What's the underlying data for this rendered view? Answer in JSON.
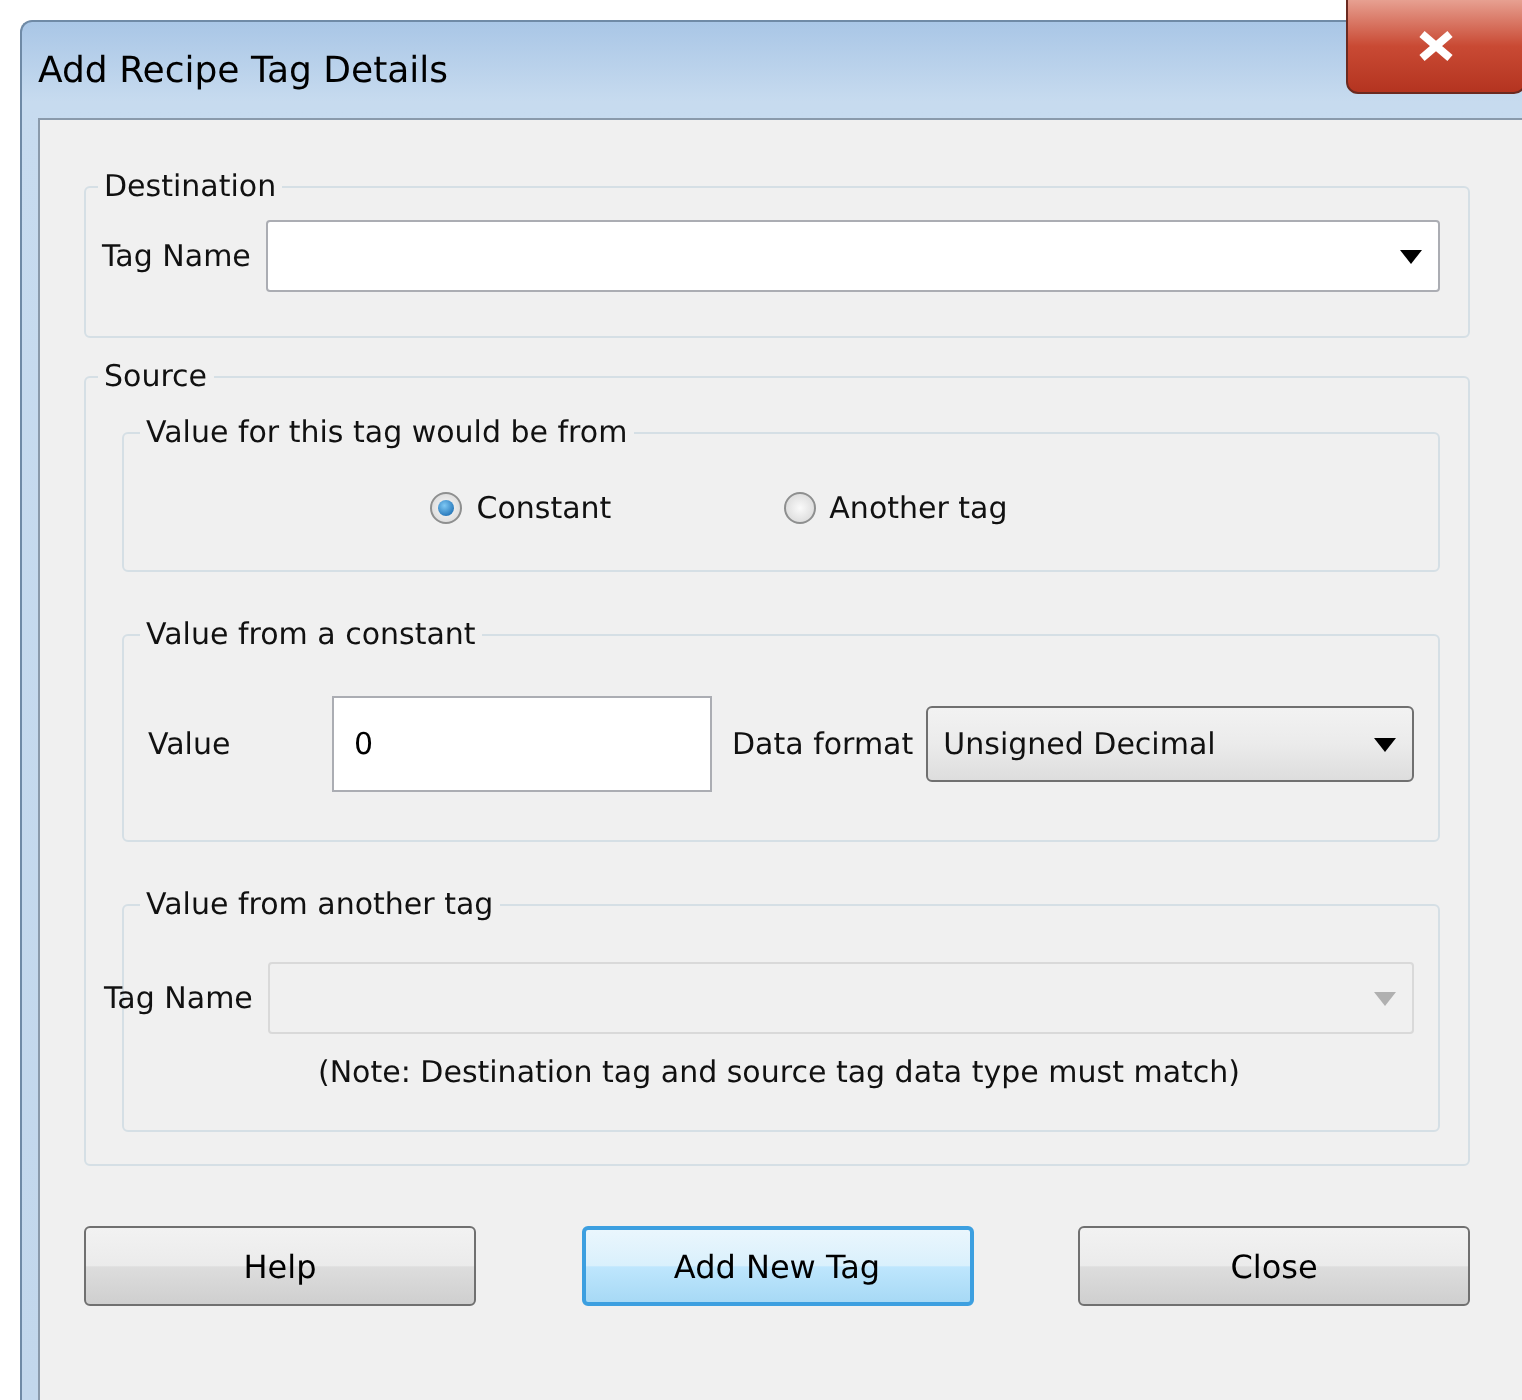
{
  "window": {
    "title": "Add Recipe Tag Details"
  },
  "destination": {
    "title": "Destination",
    "tag_name": {
      "label": "Tag Name",
      "disabled": false
    }
  },
  "source": {
    "title": "Source",
    "value_from": {
      "title": "Value for this tag would be from",
      "options": [
        {
          "label": "Constant",
          "selected": true
        },
        {
          "label": "Another tag",
          "selected": false
        }
      ]
    },
    "constant": {
      "title": "Value from a constant",
      "value_label": "Value",
      "value": "0",
      "format_label": "Data format",
      "format": "Unsigned Decimal"
    },
    "another_tag": {
      "title": "Value from another tag",
      "tag_name": {
        "label": "Tag Name",
        "disabled": true
      },
      "note": "(Note:  Destination tag and source tag data type must match)"
    }
  },
  "buttons": [
    {
      "label": "Help",
      "focused": false
    },
    {
      "label": "Add New Tag",
      "focused": true
    },
    {
      "label": "Close",
      "focused": false
    }
  ]
}
